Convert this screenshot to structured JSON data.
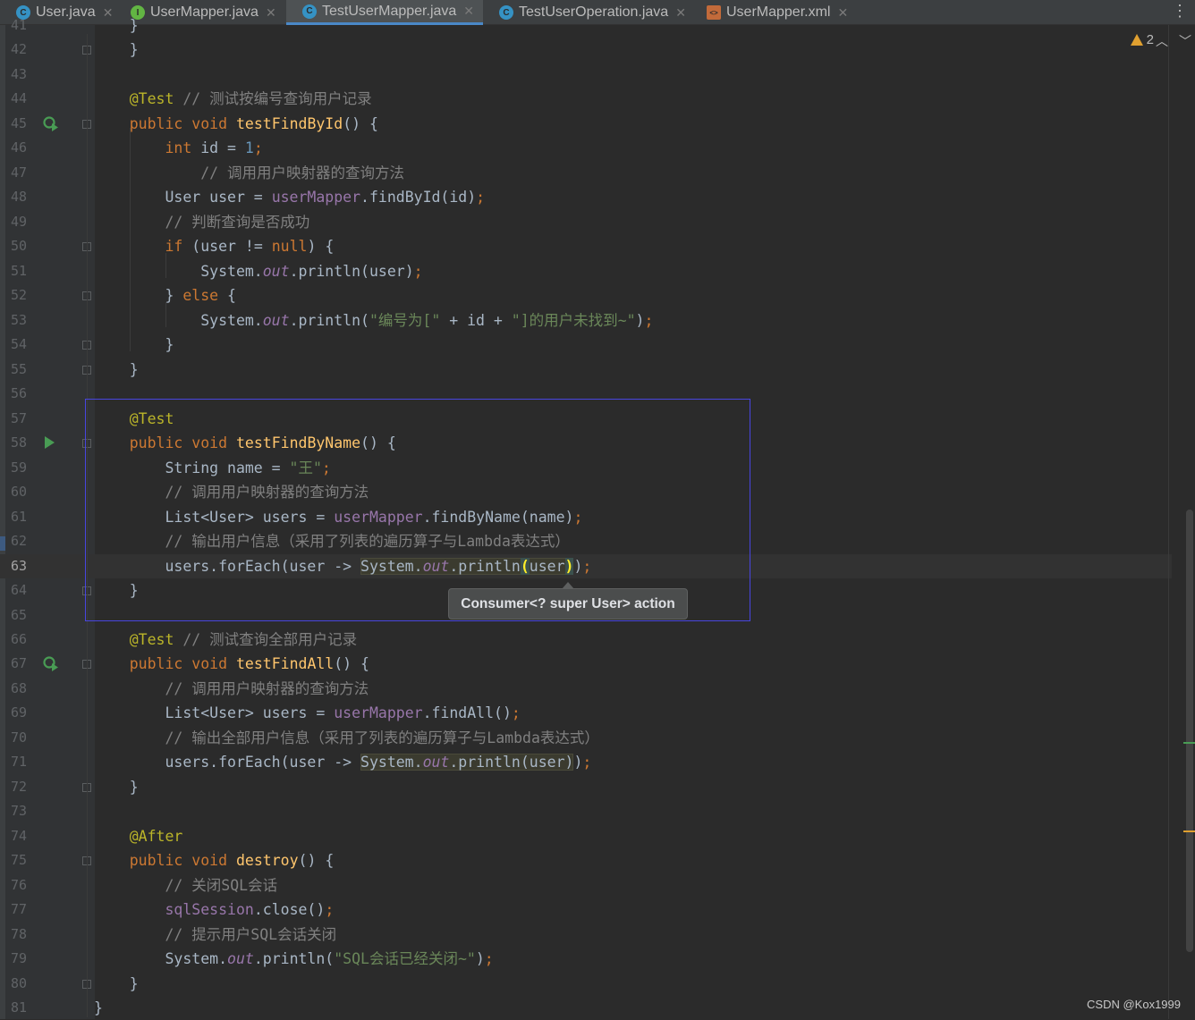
{
  "tabs": [
    {
      "label": "User.java",
      "icon": "class-icon",
      "icon_letter": "C",
      "color": "#3592c4",
      "active": false
    },
    {
      "label": "UserMapper.java",
      "icon": "interface-icon",
      "icon_letter": "I",
      "color": "#62b543",
      "active": false
    },
    {
      "label": "TestUserMapper.java",
      "icon": "test-class-icon",
      "icon_letter": "C",
      "color": "#3592c4",
      "active": true
    },
    {
      "label": "TestUserOperation.java",
      "icon": "test-class-icon",
      "icon_letter": "C",
      "color": "#3592c4",
      "active": false
    },
    {
      "label": "UserMapper.xml",
      "icon": "xml-file-icon",
      "icon_letter": "<>",
      "color": "#c26a3a",
      "active": false
    }
  ],
  "inspection": {
    "warnings": "2"
  },
  "tooltip": {
    "text": "Consumer<? super User> action"
  },
  "watermark": "CSDN @Kox1999",
  "current_line": "63",
  "lines": [
    {
      "n": "41",
      "html": "    }"
    },
    {
      "n": "42",
      "html": "    }"
    },
    {
      "n": "43",
      "html": ""
    },
    {
      "n": "44",
      "html": "    <span class='an'>@Test</span> <span class='cm'>// 测试按编号查询用户记录</span>"
    },
    {
      "n": "45",
      "html": "    <span class='kw'>public void</span> <span class='fn'>testFindById</span>() {"
    },
    {
      "n": "46",
      "html": "        <span class='kw'>int</span> id = <span class='num'>1</span><span class='kw'>;</span>"
    },
    {
      "n": "47",
      "html": "            <span class='cm'>// 调用用户映射器的查询方法</span>"
    },
    {
      "n": "48",
      "html": "        User user = <span class='fld'>userMapper</span>.findById(id)<span class='kw'>;</span>"
    },
    {
      "n": "49",
      "html": "        <span class='cm'>// 判断查询是否成功</span>"
    },
    {
      "n": "50",
      "html": "        <span class='kw'>if</span> (user != <span class='kw'>null</span>) {"
    },
    {
      "n": "51",
      "html": "            System.<span class='st'>out</span>.println(user)<span class='kw'>;</span>"
    },
    {
      "n": "52",
      "html": "        } <span class='kw'>else</span> {"
    },
    {
      "n": "53",
      "html": "            System.<span class='st'>out</span>.println(<span class='str'>\"编号为[\"</span> + id + <span class='str'>\"]的用户未找到~\"</span>)<span class='kw'>;</span>"
    },
    {
      "n": "54",
      "html": "        }"
    },
    {
      "n": "55",
      "html": "    }"
    },
    {
      "n": "56",
      "html": ""
    },
    {
      "n": "57",
      "html": "    <span class='an'>@Test</span>"
    },
    {
      "n": "58",
      "html": "    <span class='kw'>public void</span> <span class='fn'>testFindByName</span>() {"
    },
    {
      "n": "59",
      "html": "        String name = <span class='str'>\"王\"</span><span class='kw'>;</span>"
    },
    {
      "n": "60",
      "html": "        <span class='cm'>// 调用用户映射器的查询方法</span>"
    },
    {
      "n": "61",
      "html": "        List&lt;User&gt; users = <span class='fld'>userMapper</span>.findByName(name)<span class='kw'>;</span>"
    },
    {
      "n": "62",
      "html": "        <span class='cm'>// 输出用户信息（采用了列表的遍历算子与Lambda表达式）</span>"
    },
    {
      "n": "63",
      "html": "        users.forEach(user -&gt; <span class='hl'>System.<span class='st'>out</span>.println<span class='brace'>(</span>user<span class='brace'>)</span></span>)<span class='kw'>;</span>"
    },
    {
      "n": "64",
      "html": "    }"
    },
    {
      "n": "65",
      "html": ""
    },
    {
      "n": "66",
      "html": "    <span class='an'>@Test</span> <span class='cm'>// 测试查询全部用户记录</span>"
    },
    {
      "n": "67",
      "html": "    <span class='kw'>public void</span> <span class='fn'>testFindAll</span>() {"
    },
    {
      "n": "68",
      "html": "        <span class='cm'>// 调用用户映射器的查询方法</span>"
    },
    {
      "n": "69",
      "html": "        List&lt;User&gt; users = <span class='fld'>userMapper</span>.findAll()<span class='kw'>;</span>"
    },
    {
      "n": "70",
      "html": "        <span class='cm'>// 输出全部用户信息（采用了列表的遍历算子与Lambda表达式）</span>"
    },
    {
      "n": "71",
      "html": "        users.forEach(user -&gt; <span class='hl'>System.<span class='st'>out</span>.println(user)</span>)<span class='kw'>;</span>"
    },
    {
      "n": "72",
      "html": "    }"
    },
    {
      "n": "73",
      "html": ""
    },
    {
      "n": "74",
      "html": "    <span class='an'>@After</span>"
    },
    {
      "n": "75",
      "html": "    <span class='kw'>public void</span> <span class='fn'>destroy</span>() {"
    },
    {
      "n": "76",
      "html": "        <span class='cm'>// 关闭SQL会话</span>"
    },
    {
      "n": "77",
      "html": "        <span class='fld'>sqlSession</span>.close()<span class='kw'>;</span>"
    },
    {
      "n": "78",
      "html": "        <span class='cm'>// 提示用户SQL会话关闭</span>"
    },
    {
      "n": "79",
      "html": "        System.<span class='st'>out</span>.println(<span class='str'>\"SQL会话已经关闭~\"</span>)<span class='kw'>;</span>"
    },
    {
      "n": "80",
      "html": "    }"
    },
    {
      "n": "81",
      "html": "}"
    }
  ]
}
